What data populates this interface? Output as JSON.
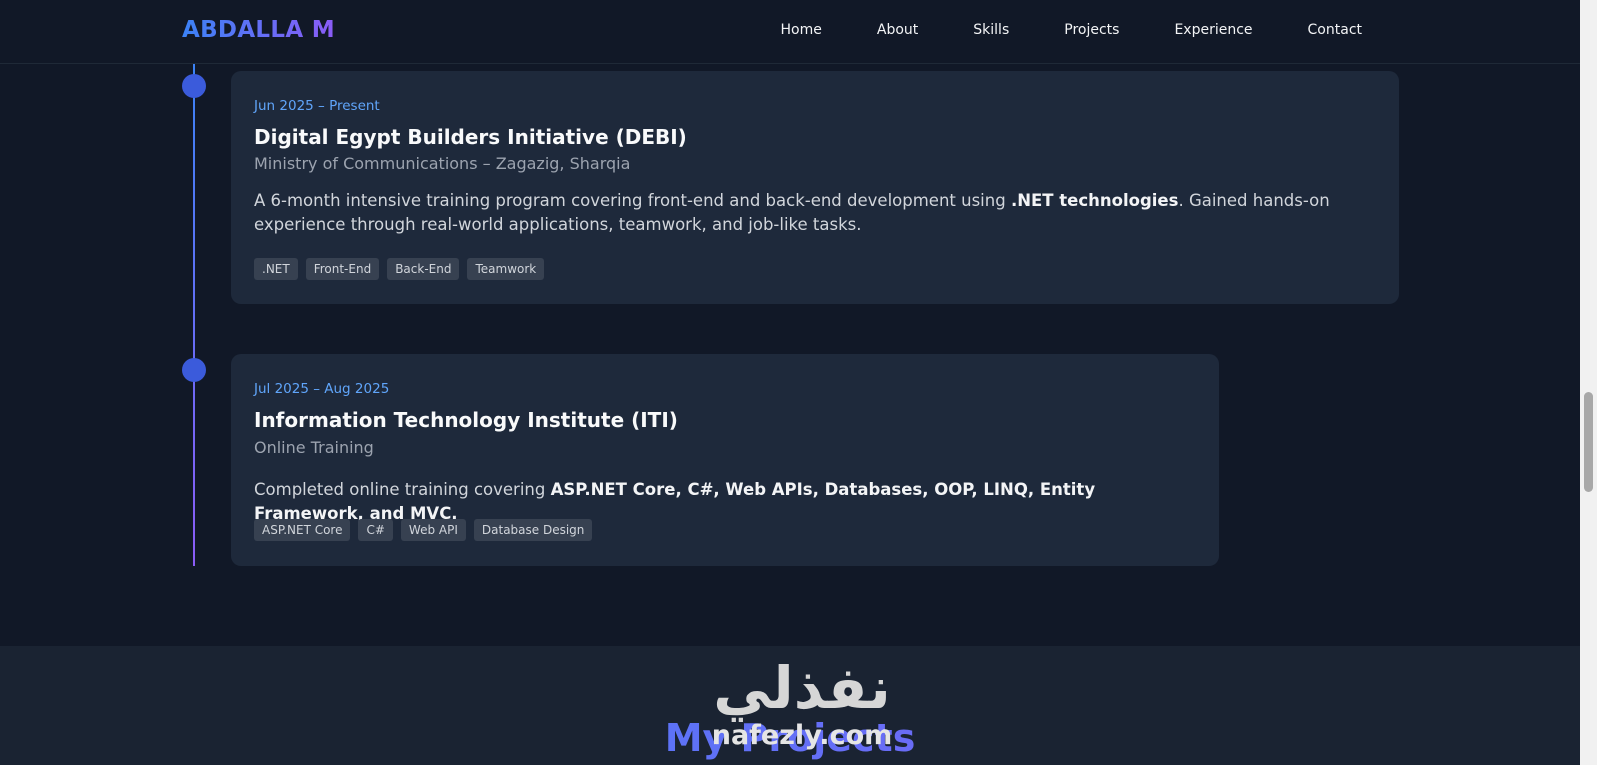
{
  "navbar": {
    "brand": "ABDALLA M",
    "links": [
      "Home",
      "About",
      "Skills",
      "Projects",
      "Experience",
      "Contact"
    ]
  },
  "experience": [
    {
      "date": "Jun 2025 – Present",
      "title": "Digital Egypt Builders Initiative (DEBI)",
      "org": "Ministry of Communications – Zagazig, Sharqia",
      "desc_pre": "A 6-month intensive training program covering front-end and back-end development using ",
      "desc_bold": ".NET technologies",
      "desc_post": ". Gained hands-on experience through real-world applications, teamwork, and job-like tasks.",
      "tags": [
        ".NET",
        "Front-End",
        "Back-End",
        "Teamwork"
      ]
    },
    {
      "date": "Jul 2025 – Aug 2025",
      "title": "Information Technology Institute (ITI)",
      "org": "Online Training",
      "desc_pre": "Completed online training covering ",
      "desc_bold": "ASP.NET Core, C#, Web APIs, Databases, OOP, LINQ, Entity Framework, and MVC.",
      "desc_post": "",
      "tags": [
        "ASP.NET Core",
        "C#",
        "Web API",
        "Database Design"
      ]
    }
  ],
  "projects": {
    "title": "My Projects"
  },
  "watermark": {
    "arabic": "نفذلي",
    "latin": "nafezly.com"
  },
  "colors": {
    "background": "#111827",
    "card": "#1e293b",
    "accent_blue": "#3b82f6",
    "accent_purple": "#8b5cf6",
    "date": "#60a5fa"
  }
}
